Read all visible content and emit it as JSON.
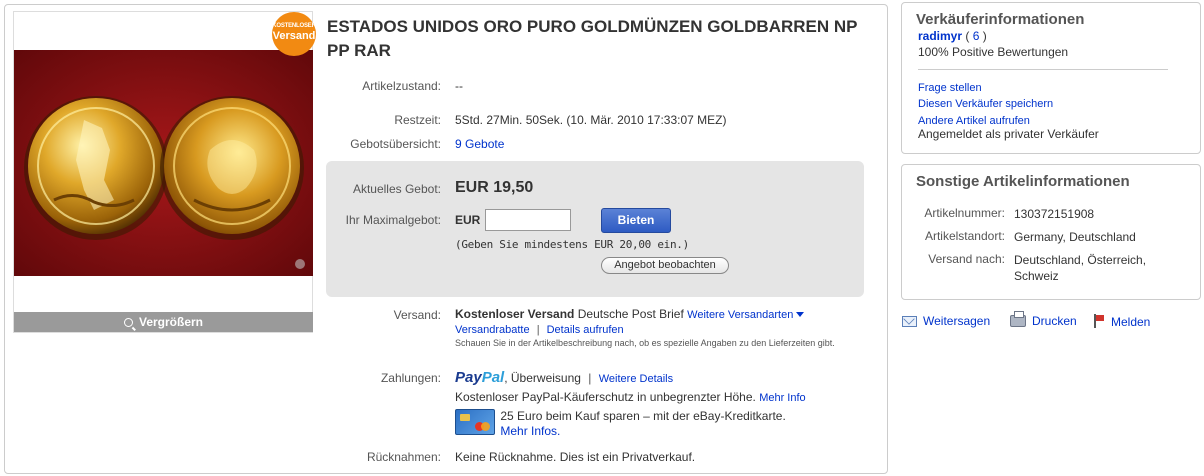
{
  "listing": {
    "title": "ESTADOS UNIDOS ORO PURO GOLDMÜNZEN GOLDBARREN NP PP RAR",
    "badge_small": "KOSTENLOSER",
    "badge_big": "Versand",
    "enlarge_label": "Vergrößern"
  },
  "details": {
    "condition_label": "Artikelzustand:",
    "condition_value": "--",
    "time_left_label": "Restzeit:",
    "time_left_value": "5Std. 27Min. 50Sek. (10. Mär. 2010 17:33:07 MEZ)",
    "bid_history_label": "Gebotsübersicht:",
    "bid_history_value": "9 Gebote"
  },
  "bid": {
    "current_label": "Aktuelles Gebot:",
    "current_value": "EUR 19,50",
    "max_label": "Ihr Maximalgebot:",
    "currency": "EUR",
    "max_input_value": "",
    "bid_button": "Bieten",
    "min_hint": "(Geben Sie mindestens EUR 20,00 ein.)",
    "watch_button": "Angebot beobachten"
  },
  "shipping": {
    "label": "Versand:",
    "free_shipping": "Kostenloser Versand",
    "carrier": "Deutsche Post Brief",
    "more_options": "Weitere Versandarten",
    "discounts": "Versandrabatte",
    "separator": "|",
    "details_link": "Details aufrufen",
    "note": "Schauen Sie in der Artikelbeschreibung nach, ob es spezielle Angaben zu den Lieferzeiten gibt."
  },
  "payment": {
    "label": "Zahlungen:",
    "paypal_a": "Pay",
    "paypal_b": "Pal",
    "methods": ", Überweisung",
    "separator": "|",
    "more_details": "Weitere Details",
    "protection": "Kostenloser PayPal-Käuferschutz in unbegrenzter Höhe.",
    "more_info": "Mehr Info",
    "card_promo": "25 Euro beim Kauf sparen – mit der eBay-Kreditkarte.",
    "card_more": "Mehr Infos."
  },
  "returns": {
    "label": "Rücknahmen:",
    "value": "Keine Rücknahme. Dies ist ein Privatverkauf."
  },
  "seller": {
    "title": "Verkäuferinformationen",
    "name": "radimyr",
    "score_open": " ( ",
    "score": "6",
    "score_close": " )",
    "positive": "100% Positive Bewertungen",
    "ask_question": "Frage stellen",
    "save_seller": "Diesen Verkäufer speichern",
    "other_items": "Andere Artikel aufrufen",
    "registered": "Angemeldet als privater Verkäufer"
  },
  "item_info": {
    "title": "Sonstige Artikelinformationen",
    "number_label": "Artikelnummer:",
    "number_value": "130372151908",
    "location_label": "Artikelstandort:",
    "location_value": "Germany, Deutschland",
    "ships_to_label": "Versand nach:",
    "ships_to_value": "Deutschland, Österreich, Schweiz"
  },
  "actions": {
    "share": "Weitersagen",
    "print": "Drucken",
    "report": "Melden"
  },
  "colors": {
    "link": "#0033cc",
    "badge": "#f28a12",
    "bid_button": "#2e5bc3",
    "photo_background": "#7a0d0f"
  }
}
